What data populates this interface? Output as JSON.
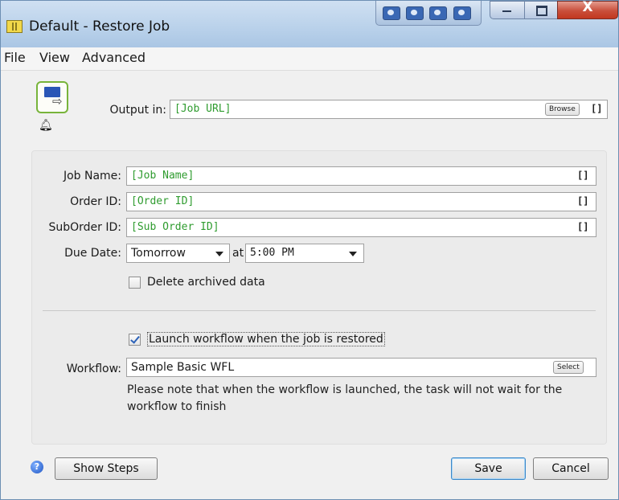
{
  "window": {
    "title": "Default - Restore Job",
    "minimize": "",
    "maximize": "",
    "close": "X"
  },
  "menu": {
    "file": "File",
    "view": "View",
    "advanced": "Advanced"
  },
  "output": {
    "label": "Output in:",
    "value": "[Job URL]",
    "browse": "Browse",
    "bracket": "[]"
  },
  "job": {
    "name_label": "Job Name:",
    "name_value": "[Job Name]",
    "order_label": "Order ID:",
    "order_value": "[Order ID]",
    "suborder_label": "SubOrder ID:",
    "suborder_value": "[Sub Order ID]",
    "bracket": "[]"
  },
  "due": {
    "label": "Due Date:",
    "date": "Tomorrow",
    "at": "at",
    "time": "5:00 PM"
  },
  "delete_archived": {
    "label": "Delete archived data",
    "checked": false
  },
  "launch": {
    "label": "Launch workflow when the job is restored",
    "checked": true
  },
  "workflow": {
    "label": "Workflow:",
    "value": "Sample Basic WFL",
    "select": "Select",
    "note": "Please note that when the workflow is launched, the task will not wait for the workflow to finish"
  },
  "footer": {
    "help": "?",
    "show_steps": "Show Steps",
    "save": "Save",
    "cancel": "Cancel"
  },
  "icons": [
    "app-icon",
    "job-settings-icon",
    "bell-icon",
    "help-icon",
    "dropdown-caret-icon"
  ],
  "colors": {
    "field_value": "#2f9c2f",
    "accent_border": "#78b43b",
    "close_button": "#c94f3b"
  }
}
